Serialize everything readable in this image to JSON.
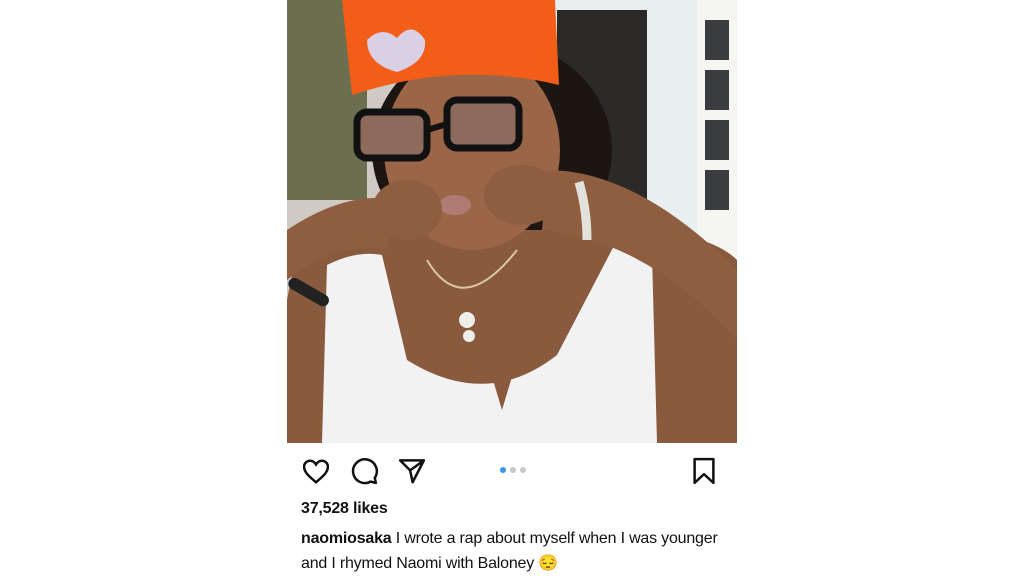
{
  "post": {
    "likes": "37,528 likes",
    "username": "naomiosaka",
    "caption": "I wrote a rap about myself when I was younger and I rhymed Naomi with Baloney",
    "caption_emoji": "😔",
    "carousel": {
      "count": 3,
      "active_index": 0
    }
  },
  "icons": {
    "like": "heart-icon",
    "comment": "comment-icon",
    "share": "paper-plane-icon",
    "save": "bookmark-icon"
  },
  "colors": {
    "text": "#111111",
    "dot_active": "#3897f0",
    "dot_inactive": "#c7c7c7",
    "hat_orange": "#f25d17"
  }
}
